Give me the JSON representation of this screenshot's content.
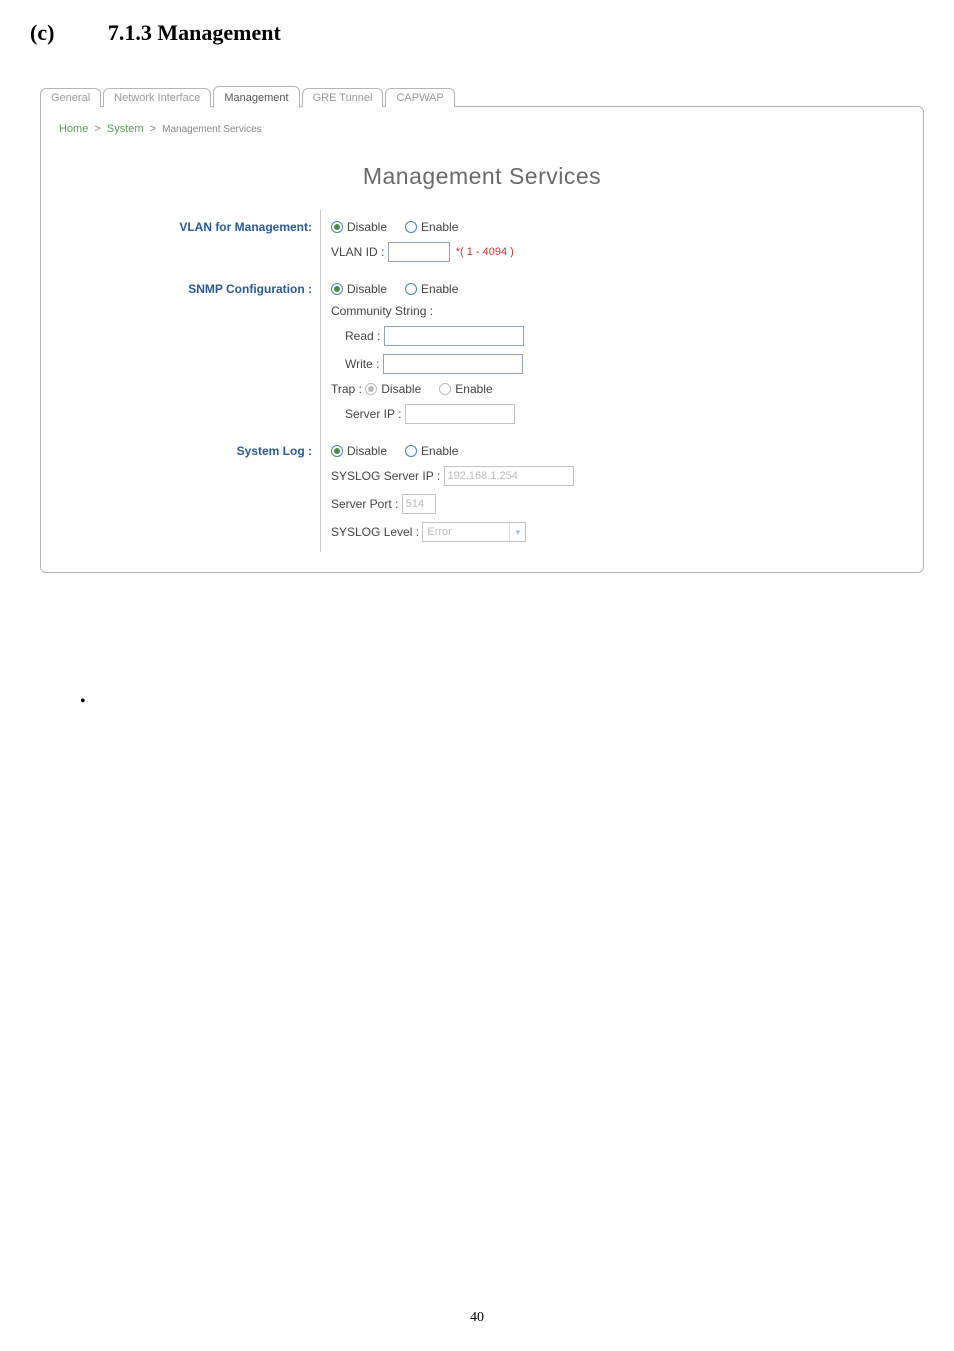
{
  "doc": {
    "section_marker": "(c)",
    "section_title": "7.1.3 Management",
    "page_number": "40"
  },
  "tabs": {
    "general": "General",
    "network_interface": "Network Interface",
    "management": "Management",
    "gre_tunnel": "GRE Tunnel",
    "capwap": "CAPWAP"
  },
  "breadcrumb": {
    "home": "Home",
    "system": "System",
    "current": "Management Services"
  },
  "panel": {
    "title": "Management Services"
  },
  "labels": {
    "vlan_management": "VLAN for Management:",
    "snmp_config": "SNMP Configuration :",
    "system_log": "System Log :"
  },
  "radio": {
    "disable": "Disable",
    "enable": "Enable"
  },
  "vlan": {
    "id_label": "VLAN ID :",
    "id_value": "",
    "hint": "*( 1 - 4094 )"
  },
  "snmp": {
    "community_label": "Community String :",
    "read_label": "Read :",
    "read_value": "",
    "write_label": "Write :",
    "write_value": "",
    "trap_label": "Trap :",
    "server_ip_label": "Server IP :",
    "server_ip_value": ""
  },
  "syslog": {
    "server_ip_label": "SYSLOG Server IP :",
    "server_ip_value": "192.168.1.254",
    "server_port_label": "Server Port :",
    "server_port_value": "514",
    "level_label": "SYSLOG Level :",
    "level_value": "Error"
  }
}
